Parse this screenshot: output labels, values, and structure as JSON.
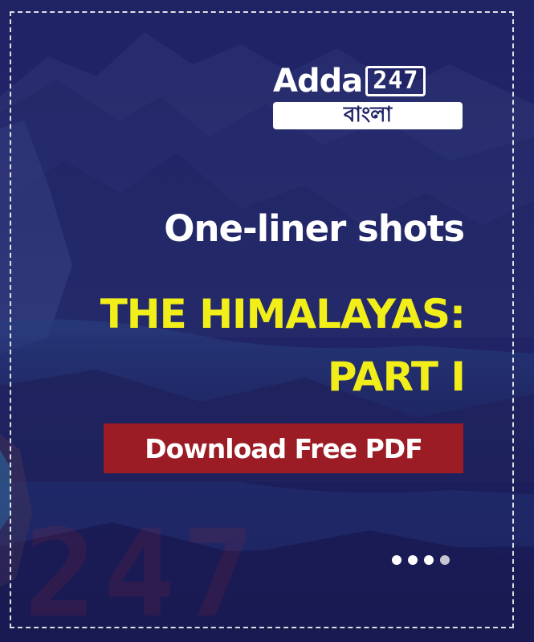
{
  "logo": {
    "word": "Adda",
    "number": "247",
    "sub": "বাংলা"
  },
  "subtitle": "One-liner shots",
  "title": {
    "line1": "THE HIMALAYAS:",
    "line2": "PART I"
  },
  "cta": {
    "label": "Download Free PDF"
  },
  "carousel": {
    "dot_count": 4
  },
  "watermark": "247",
  "colors": {
    "background": "#1c1d5a",
    "title_yellow": "#f2ee1a",
    "cta_red": "#9b1c24",
    "text_white": "#ffffff",
    "logo_sub_text": "#1e2466"
  }
}
